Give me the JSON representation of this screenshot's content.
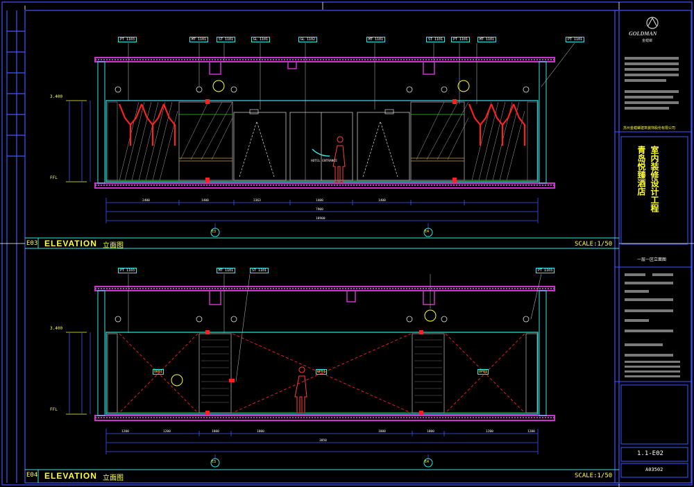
{
  "elevations": [
    {
      "code": "E03",
      "title": "ELEVATION",
      "title_cn": "立面图",
      "scale": "SCALE:1/50",
      "top_tags": [
        "PT 1103",
        "MT 1101",
        "ST 1101",
        "GL 1101",
        "GL 1102",
        "MT 1101",
        "ST 1101",
        "PT 1101",
        "MT 1101",
        "PT 1101"
      ],
      "level_top": "3.400",
      "level_floor": "FFL",
      "dims": [
        "2400",
        "1400",
        "3363",
        "1400",
        "1400",
        "7900",
        "18900"
      ],
      "entrance": "HOTEL ENTRANCE",
      "grid": [
        "E3",
        "E4"
      ]
    },
    {
      "code": "E04",
      "title": "ELEVATION",
      "title_cn": "立面图",
      "scale": "SCALE:1/50",
      "top_tags": [
        "PT 1103",
        "MT 1101",
        "ST 1101",
        "PT 1103"
      ],
      "level_top": "3.400",
      "level_floor": "FFL",
      "dims": [
        "1200",
        "1200",
        "1800",
        "1800",
        "3850",
        "1800",
        "1800",
        "1200",
        "1200"
      ],
      "panel_tags": [
        "OP01",
        "OP01",
        "OP01"
      ],
      "grid": [
        "E3",
        "E4"
      ]
    }
  ],
  "title_block": {
    "logo": "GOLDMAN",
    "logo_cn": "金螳螂",
    "company_cn": "苏州金螳螂建筑装饰股份有限公司",
    "project_cn_1": "青岛悦臻酒店",
    "project_cn_2": "室内装修设计工程",
    "drawing_name_cn": "一层一区立面图",
    "drawing_no": "1.1-E02",
    "sheet_code": "A03502"
  },
  "colors": {
    "frame": "#3f56ff",
    "cyan": "#33e6e6",
    "magenta": "#cc33cc",
    "red": "#ff2020",
    "yellow": "#ffff33",
    "green": "#33cc33",
    "gray": "#a8a8a8"
  }
}
